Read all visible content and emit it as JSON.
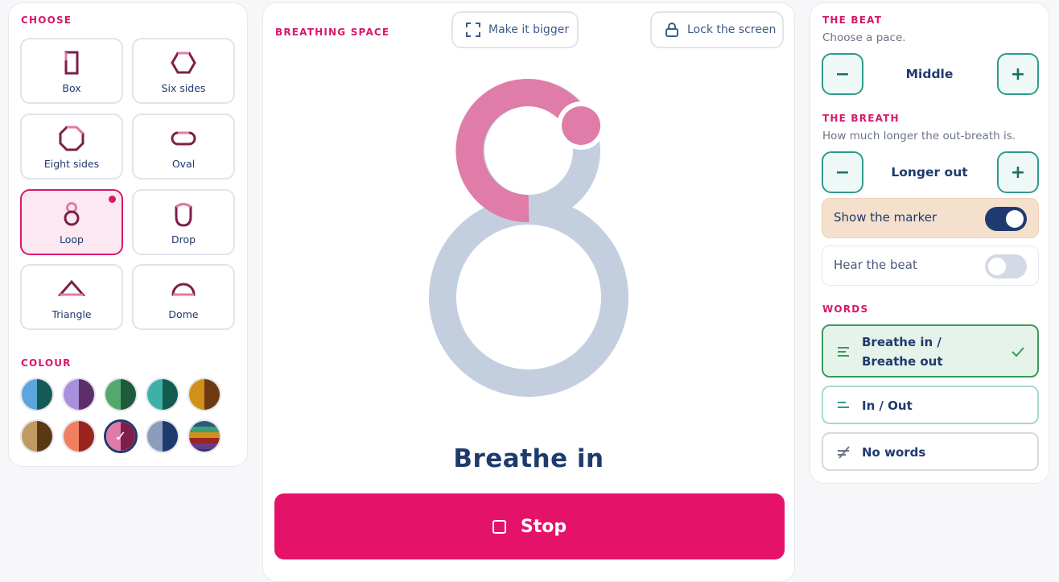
{
  "left": {
    "choose_label": "CHOOSE",
    "shapes": [
      {
        "label": "Box",
        "icon": "box-shape-icon"
      },
      {
        "label": "Six sides",
        "icon": "hexagon-shape-icon"
      },
      {
        "label": "Eight sides",
        "icon": "octagon-shape-icon"
      },
      {
        "label": "Oval",
        "icon": "oval-shape-icon"
      },
      {
        "label": "Loop",
        "icon": "loop-shape-icon",
        "selected": true
      },
      {
        "label": "Drop",
        "icon": "drop-shape-icon"
      },
      {
        "label": "Triangle",
        "icon": "triangle-shape-icon"
      },
      {
        "label": "Dome",
        "icon": "dome-shape-icon"
      }
    ],
    "colour_label": "COLOUR",
    "colours": [
      {
        "left": "#5aa6dd",
        "right": "#145b57"
      },
      {
        "left": "#a98fdc",
        "right": "#5e2d6b"
      },
      {
        "left": "#54a86c",
        "right": "#1e5b3a"
      },
      {
        "left": "#3fb0a7",
        "right": "#145b4f"
      },
      {
        "left": "#d0901a",
        "right": "#6e3a12"
      },
      {
        "left": "#c09a63",
        "right": "#5a3814"
      },
      {
        "left": "#f08060",
        "right": "#9a2420"
      },
      {
        "left": "#e07aa8",
        "right": "#7d1f48",
        "selected": true
      },
      {
        "left": "#8c9cbc",
        "right": "#1f3a6e"
      },
      {
        "left": "stripes",
        "right": "stripes"
      }
    ]
  },
  "center": {
    "section_label": "BREATHING SPACE",
    "bigger_label": "Make it bigger",
    "lock_label": "Lock the screen",
    "breath_text": "Breathe in",
    "stop_label": "Stop",
    "loop_progress": 0.18
  },
  "right": {
    "beat_label": "THE BEAT",
    "beat_help": "Choose a pace.",
    "beat_value": "Middle",
    "breath_label": "THE BREATH",
    "breath_help": "How much longer the out-breath is.",
    "breath_value": "Longer out",
    "minus": "−",
    "plus": "+",
    "marker_label": "Show the marker",
    "marker_on": true,
    "beat_sound_label": "Hear the beat",
    "beat_sound_on": false,
    "words_label": "WORDS",
    "words": [
      {
        "line1": "Breathe in /",
        "line2": "Breathe out",
        "selected": true
      },
      {
        "line1": "In / Out"
      },
      {
        "line1": "No words"
      }
    ]
  },
  "colors": {
    "accent": "#e5126a",
    "navy": "#1f3a6e",
    "teal": "#2f9a8c",
    "loop_track": "#c3cfdf",
    "loop_fill": "#df7ca8"
  }
}
